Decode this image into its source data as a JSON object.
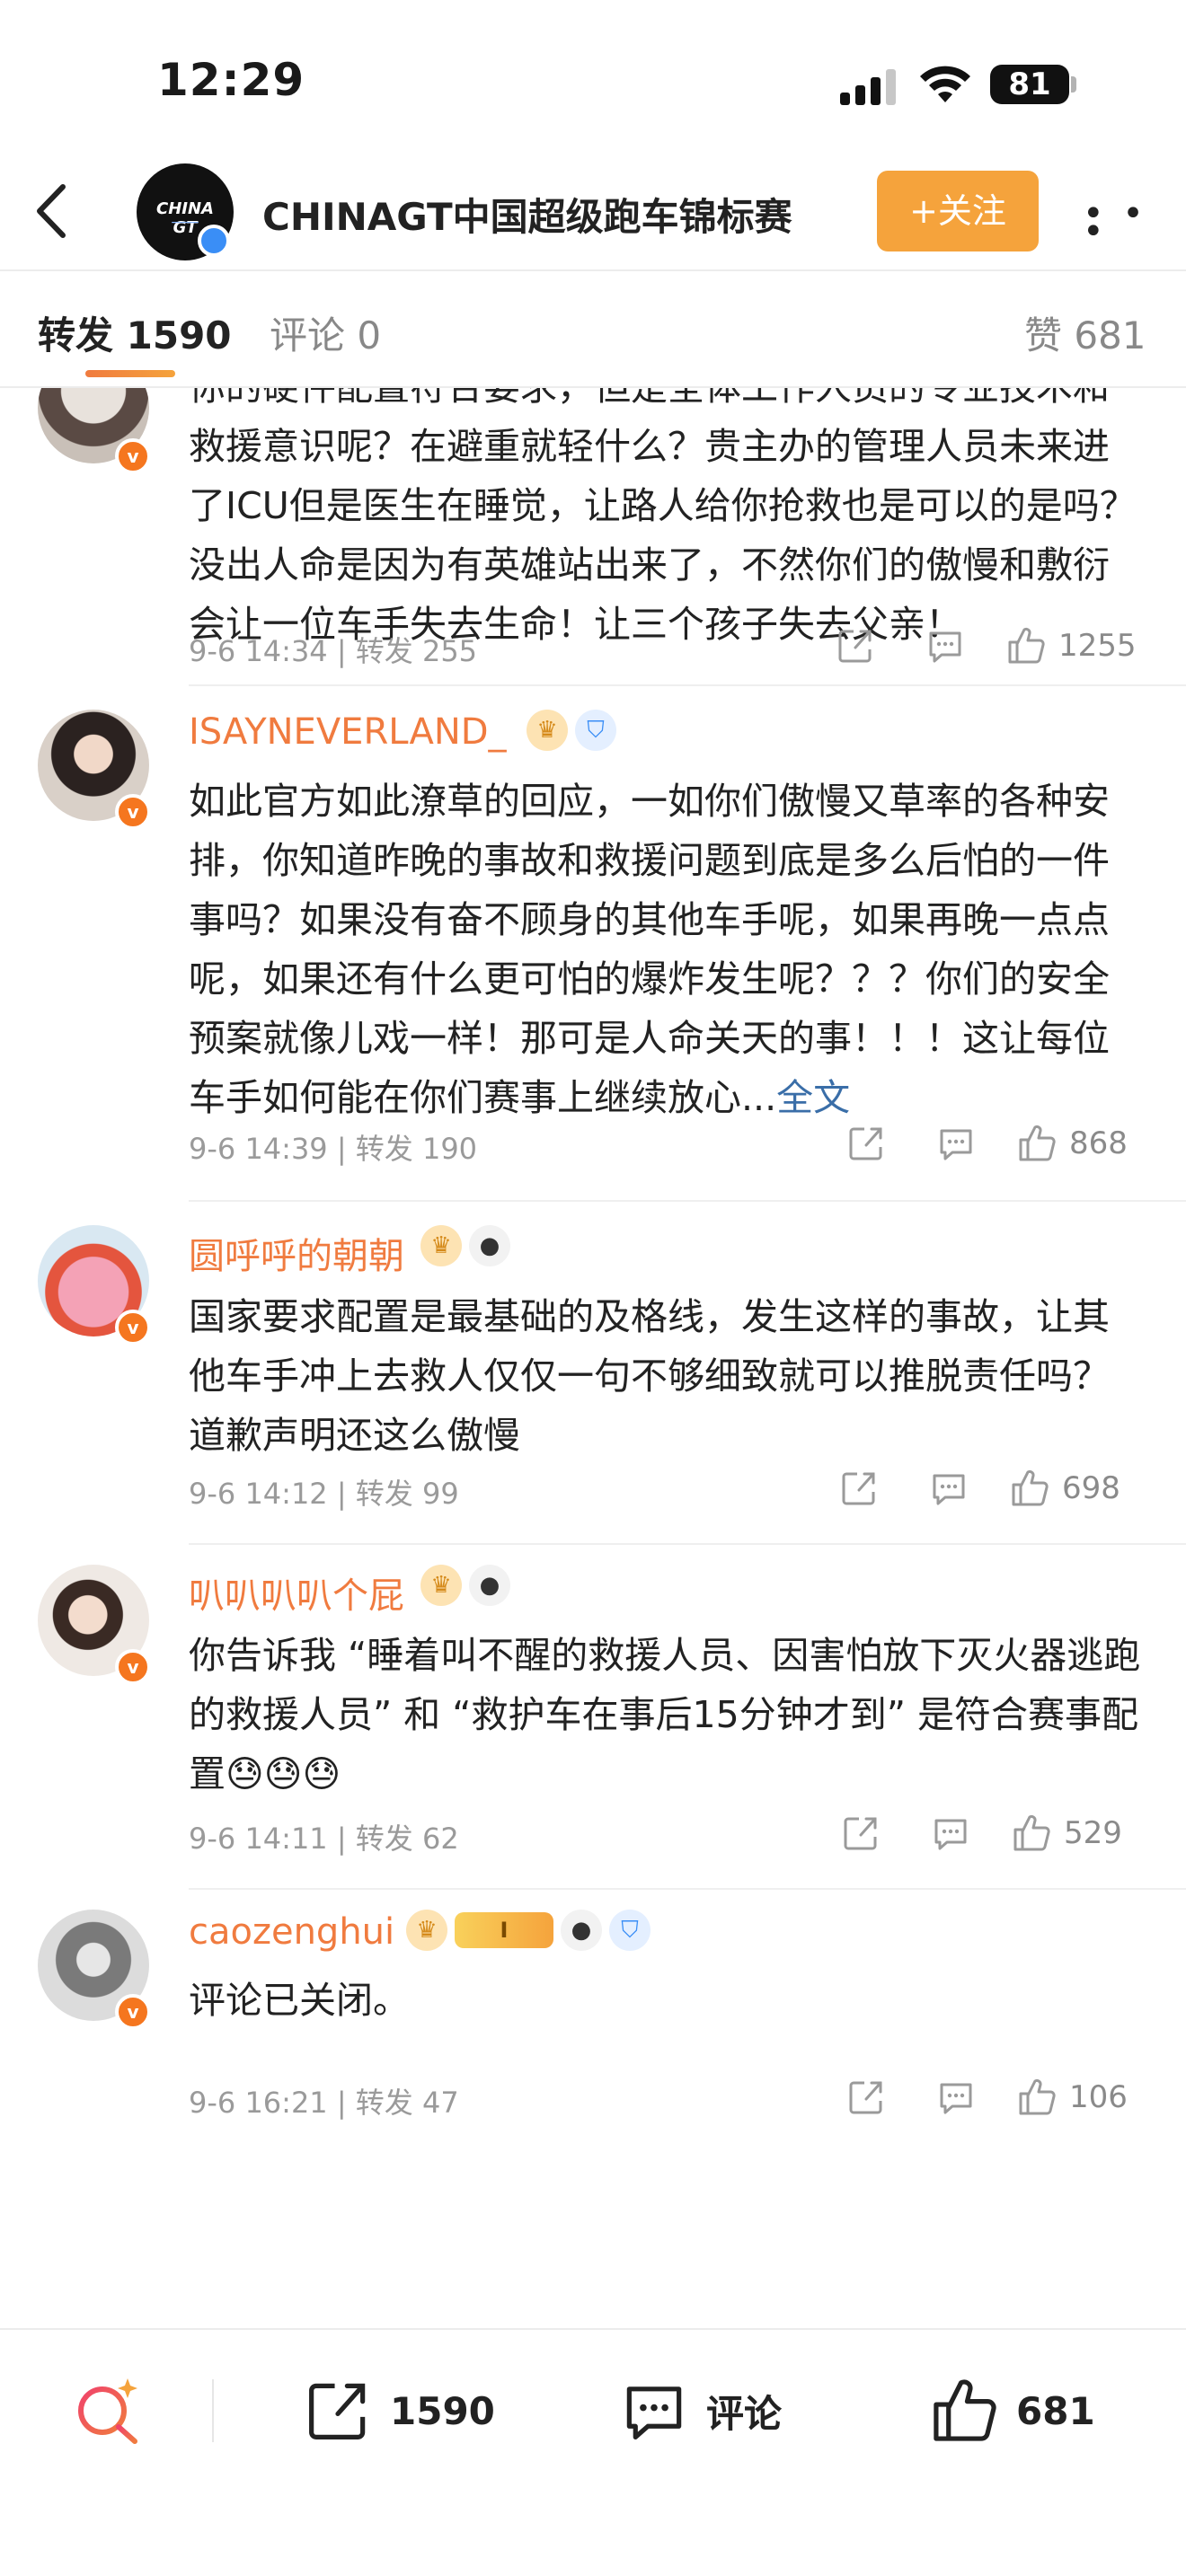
{
  "status_bar": {
    "time": "12:29",
    "battery": "81"
  },
  "header": {
    "title": "CHINAGT中国超级跑车锦标赛",
    "follow_label": "+关注",
    "avatar_logo": "CHINA GT"
  },
  "tabs": {
    "repost": "转发 1590",
    "comment": "评论 0",
    "like": "赞 681"
  },
  "items": [
    {
      "username": "",
      "text": "你的硬件配置符合要求，但是全体工作人员的专业技术和救援意识呢？在避重就轻什么？贵主办的管理人员未来进了ICU但是医生在睡觉，让路人给你抢救也是可以的是吗？没出人命是因为有英雄站出来了，不然你们的傲慢和敷衍会让一位车手失去生命！让三个孩子失去父亲！",
      "meta": "9-6 14:34 | 转发 255",
      "likes": "1255"
    },
    {
      "username": "ISAYNEVERLAND_",
      "text": "如此官方如此潦草的回应，一如你们傲慢又草率的各种安排，你知道昨晚的事故和救援问题到底是多么后怕的一件事吗？如果没有奋不顾身的其他车手呢，如果再晚一点点呢，如果还有什么更可怕的爆炸发生呢？？？你们的安全预案就像儿戏一样！那可是人命关天的事！！！这让每位车手如何能在你们赛事上继续放心...",
      "more_link": "全文",
      "meta": "9-6 14:39 | 转发 190",
      "likes": "868"
    },
    {
      "username": "圆呼呼的朝朝",
      "text": "国家要求配置是最基础的及格线，发生这样的事故，让其他车手冲上去救人仅仅一句不够细致就可以推脱责任吗？道歉声明还这么傲慢",
      "meta": "9-6 14:12 | 转发 99",
      "likes": "698"
    },
    {
      "username": "叭叭叭叭个屁",
      "text": "你告诉我 “睡着叫不醒的救援人员、因害怕放下灭火器逃跑的救援人员” 和 “救护车在事后15分钟才到” 是符合赛事配置",
      "emoji": "😓😓😓",
      "meta": "9-6 14:11 | 转发 62",
      "likes": "529"
    },
    {
      "username": "caozenghui",
      "level_badge": "I",
      "text": "评论已关闭。",
      "meta": "9-6 16:21 | 转发 47",
      "likes": "106"
    }
  ],
  "bottom_bar": {
    "repost_count": "1590",
    "comment_label": "评论",
    "like_count": "681"
  },
  "colors": {
    "accent_orange": "#f5a33c",
    "username_orange": "#f07b3f",
    "verified_orange": "#f5761f",
    "verified_blue": "#3a8ef6",
    "link_blue": "#3a6ea8"
  }
}
